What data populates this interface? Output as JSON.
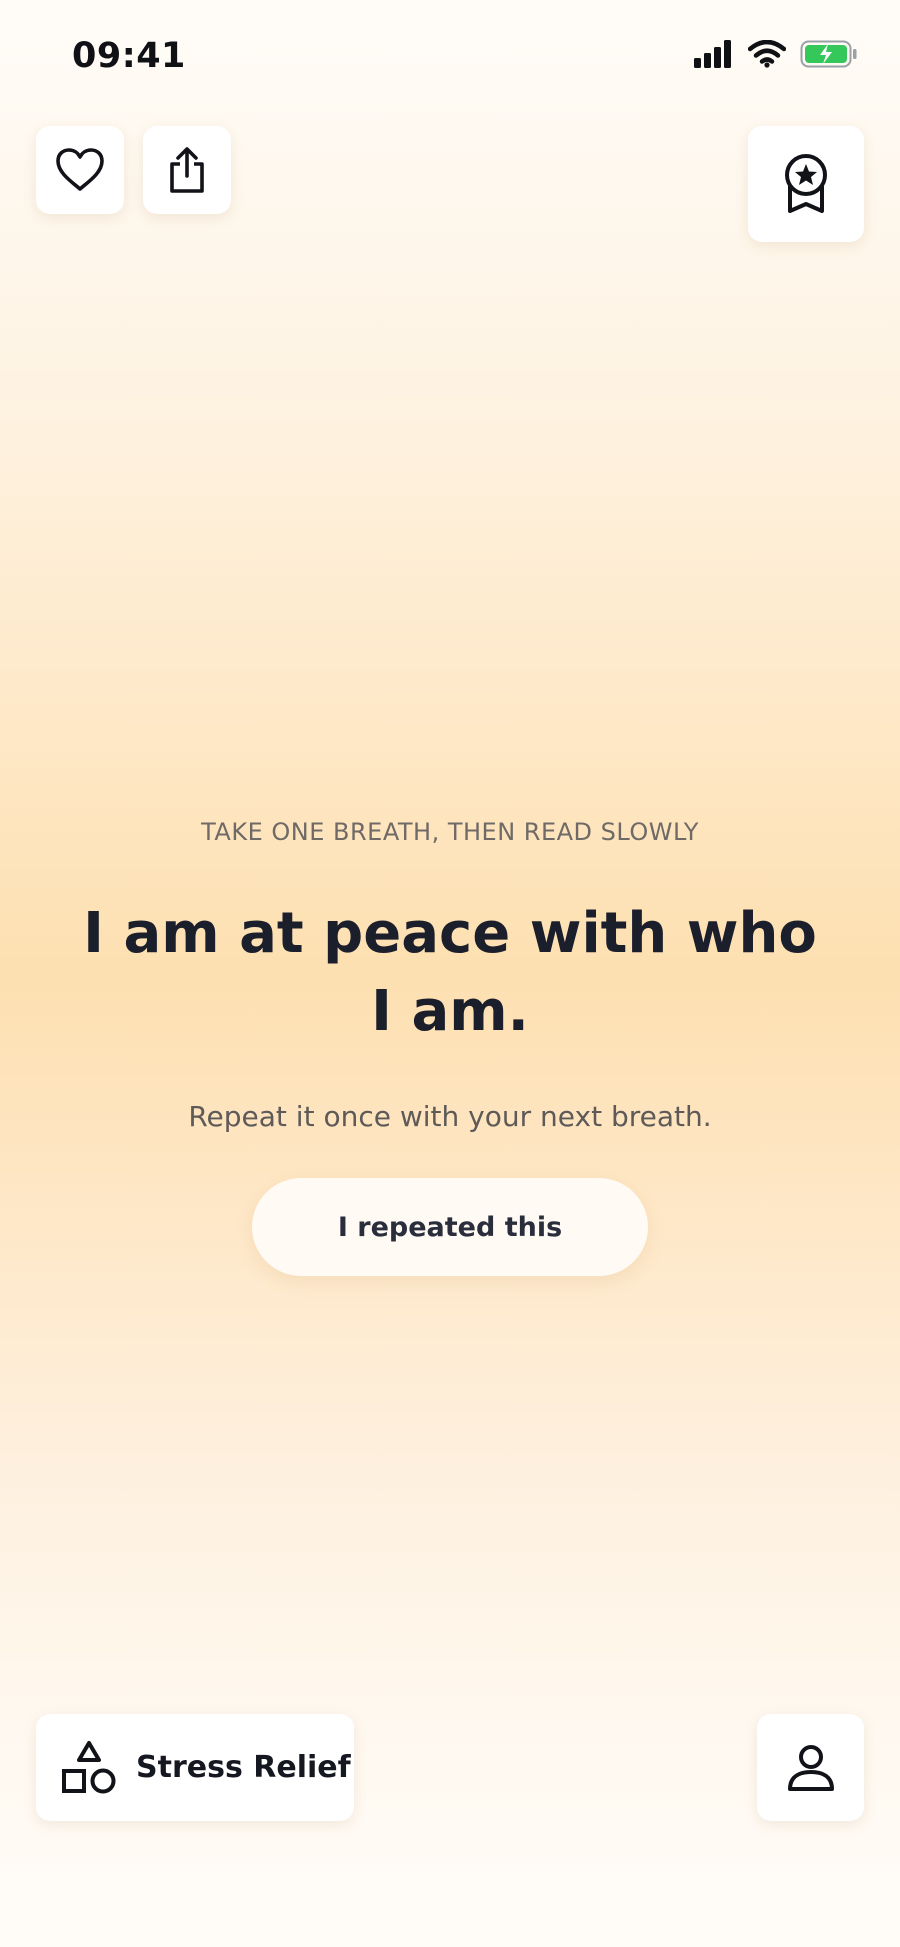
{
  "status_bar": {
    "time": "09:41",
    "icons": [
      "cellular-signal-icon",
      "wifi-icon",
      "battery-charging-icon"
    ],
    "battery_color": "#34c759"
  },
  "toolbar": {
    "favorite_icon": "heart-icon",
    "share_icon": "share-icon",
    "achievements_icon": "award-ribbon-icon"
  },
  "affirmation": {
    "eyebrow": "TAKE ONE BREATH, THEN READ SLOWLY",
    "text": "I am at peace with who I am.",
    "instruction": "Repeat it once with your next breath.",
    "action_label": "I repeated this"
  },
  "bottom_bar": {
    "category_icon": "shapes-icon",
    "category_label": "Stress Relief",
    "profile_icon": "person-icon"
  },
  "colors": {
    "background_top": "#fffcf8",
    "background_mid": "#fde0b1",
    "text_primary": "#1b1e2b",
    "text_secondary": "#6f6a66"
  }
}
